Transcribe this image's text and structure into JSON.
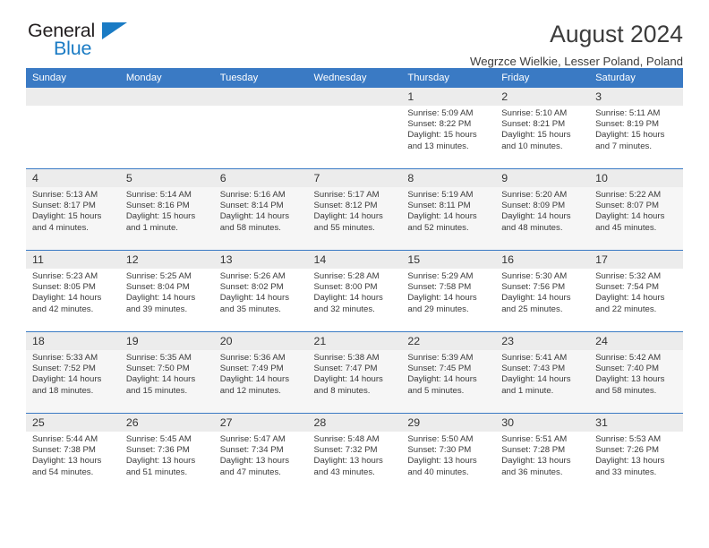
{
  "brand": {
    "name_top": "General",
    "name_bottom": "Blue",
    "accent_color": "#1a7bc4"
  },
  "header": {
    "title": "August 2024",
    "location": "Wegrzce Wielkie, Lesser Poland, Poland"
  },
  "theme": {
    "header_bar": "#3a7ac4",
    "daynum_band": "#ececec",
    "alt_row": "#f6f6f6"
  },
  "weekdays": [
    "Sunday",
    "Monday",
    "Tuesday",
    "Wednesday",
    "Thursday",
    "Friday",
    "Saturday"
  ],
  "weeks": [
    [
      {
        "day": "",
        "empty": true
      },
      {
        "day": "",
        "empty": true
      },
      {
        "day": "",
        "empty": true
      },
      {
        "day": "",
        "empty": true
      },
      {
        "day": "1",
        "sunrise": "Sunrise: 5:09 AM",
        "sunset": "Sunset: 8:22 PM",
        "daylight1": "Daylight: 15 hours",
        "daylight2": "and 13 minutes."
      },
      {
        "day": "2",
        "sunrise": "Sunrise: 5:10 AM",
        "sunset": "Sunset: 8:21 PM",
        "daylight1": "Daylight: 15 hours",
        "daylight2": "and 10 minutes."
      },
      {
        "day": "3",
        "sunrise": "Sunrise: 5:11 AM",
        "sunset": "Sunset: 8:19 PM",
        "daylight1": "Daylight: 15 hours",
        "daylight2": "and 7 minutes."
      }
    ],
    [
      {
        "day": "4",
        "sunrise": "Sunrise: 5:13 AM",
        "sunset": "Sunset: 8:17 PM",
        "daylight1": "Daylight: 15 hours",
        "daylight2": "and 4 minutes."
      },
      {
        "day": "5",
        "sunrise": "Sunrise: 5:14 AM",
        "sunset": "Sunset: 8:16 PM",
        "daylight1": "Daylight: 15 hours",
        "daylight2": "and 1 minute."
      },
      {
        "day": "6",
        "sunrise": "Sunrise: 5:16 AM",
        "sunset": "Sunset: 8:14 PM",
        "daylight1": "Daylight: 14 hours",
        "daylight2": "and 58 minutes."
      },
      {
        "day": "7",
        "sunrise": "Sunrise: 5:17 AM",
        "sunset": "Sunset: 8:12 PM",
        "daylight1": "Daylight: 14 hours",
        "daylight2": "and 55 minutes."
      },
      {
        "day": "8",
        "sunrise": "Sunrise: 5:19 AM",
        "sunset": "Sunset: 8:11 PM",
        "daylight1": "Daylight: 14 hours",
        "daylight2": "and 52 minutes."
      },
      {
        "day": "9",
        "sunrise": "Sunrise: 5:20 AM",
        "sunset": "Sunset: 8:09 PM",
        "daylight1": "Daylight: 14 hours",
        "daylight2": "and 48 minutes."
      },
      {
        "day": "10",
        "sunrise": "Sunrise: 5:22 AM",
        "sunset": "Sunset: 8:07 PM",
        "daylight1": "Daylight: 14 hours",
        "daylight2": "and 45 minutes."
      }
    ],
    [
      {
        "day": "11",
        "sunrise": "Sunrise: 5:23 AM",
        "sunset": "Sunset: 8:05 PM",
        "daylight1": "Daylight: 14 hours",
        "daylight2": "and 42 minutes."
      },
      {
        "day": "12",
        "sunrise": "Sunrise: 5:25 AM",
        "sunset": "Sunset: 8:04 PM",
        "daylight1": "Daylight: 14 hours",
        "daylight2": "and 39 minutes."
      },
      {
        "day": "13",
        "sunrise": "Sunrise: 5:26 AM",
        "sunset": "Sunset: 8:02 PM",
        "daylight1": "Daylight: 14 hours",
        "daylight2": "and 35 minutes."
      },
      {
        "day": "14",
        "sunrise": "Sunrise: 5:28 AM",
        "sunset": "Sunset: 8:00 PM",
        "daylight1": "Daylight: 14 hours",
        "daylight2": "and 32 minutes."
      },
      {
        "day": "15",
        "sunrise": "Sunrise: 5:29 AM",
        "sunset": "Sunset: 7:58 PM",
        "daylight1": "Daylight: 14 hours",
        "daylight2": "and 29 minutes."
      },
      {
        "day": "16",
        "sunrise": "Sunrise: 5:30 AM",
        "sunset": "Sunset: 7:56 PM",
        "daylight1": "Daylight: 14 hours",
        "daylight2": "and 25 minutes."
      },
      {
        "day": "17",
        "sunrise": "Sunrise: 5:32 AM",
        "sunset": "Sunset: 7:54 PM",
        "daylight1": "Daylight: 14 hours",
        "daylight2": "and 22 minutes."
      }
    ],
    [
      {
        "day": "18",
        "sunrise": "Sunrise: 5:33 AM",
        "sunset": "Sunset: 7:52 PM",
        "daylight1": "Daylight: 14 hours",
        "daylight2": "and 18 minutes."
      },
      {
        "day": "19",
        "sunrise": "Sunrise: 5:35 AM",
        "sunset": "Sunset: 7:50 PM",
        "daylight1": "Daylight: 14 hours",
        "daylight2": "and 15 minutes."
      },
      {
        "day": "20",
        "sunrise": "Sunrise: 5:36 AM",
        "sunset": "Sunset: 7:49 PM",
        "daylight1": "Daylight: 14 hours",
        "daylight2": "and 12 minutes."
      },
      {
        "day": "21",
        "sunrise": "Sunrise: 5:38 AM",
        "sunset": "Sunset: 7:47 PM",
        "daylight1": "Daylight: 14 hours",
        "daylight2": "and 8 minutes."
      },
      {
        "day": "22",
        "sunrise": "Sunrise: 5:39 AM",
        "sunset": "Sunset: 7:45 PM",
        "daylight1": "Daylight: 14 hours",
        "daylight2": "and 5 minutes."
      },
      {
        "day": "23",
        "sunrise": "Sunrise: 5:41 AM",
        "sunset": "Sunset: 7:43 PM",
        "daylight1": "Daylight: 14 hours",
        "daylight2": "and 1 minute."
      },
      {
        "day": "24",
        "sunrise": "Sunrise: 5:42 AM",
        "sunset": "Sunset: 7:40 PM",
        "daylight1": "Daylight: 13 hours",
        "daylight2": "and 58 minutes."
      }
    ],
    [
      {
        "day": "25",
        "sunrise": "Sunrise: 5:44 AM",
        "sunset": "Sunset: 7:38 PM",
        "daylight1": "Daylight: 13 hours",
        "daylight2": "and 54 minutes."
      },
      {
        "day": "26",
        "sunrise": "Sunrise: 5:45 AM",
        "sunset": "Sunset: 7:36 PM",
        "daylight1": "Daylight: 13 hours",
        "daylight2": "and 51 minutes."
      },
      {
        "day": "27",
        "sunrise": "Sunrise: 5:47 AM",
        "sunset": "Sunset: 7:34 PM",
        "daylight1": "Daylight: 13 hours",
        "daylight2": "and 47 minutes."
      },
      {
        "day": "28",
        "sunrise": "Sunrise: 5:48 AM",
        "sunset": "Sunset: 7:32 PM",
        "daylight1": "Daylight: 13 hours",
        "daylight2": "and 43 minutes."
      },
      {
        "day": "29",
        "sunrise": "Sunrise: 5:50 AM",
        "sunset": "Sunset: 7:30 PM",
        "daylight1": "Daylight: 13 hours",
        "daylight2": "and 40 minutes."
      },
      {
        "day": "30",
        "sunrise": "Sunrise: 5:51 AM",
        "sunset": "Sunset: 7:28 PM",
        "daylight1": "Daylight: 13 hours",
        "daylight2": "and 36 minutes."
      },
      {
        "day": "31",
        "sunrise": "Sunrise: 5:53 AM",
        "sunset": "Sunset: 7:26 PM",
        "daylight1": "Daylight: 13 hours",
        "daylight2": "and 33 minutes."
      }
    ]
  ]
}
